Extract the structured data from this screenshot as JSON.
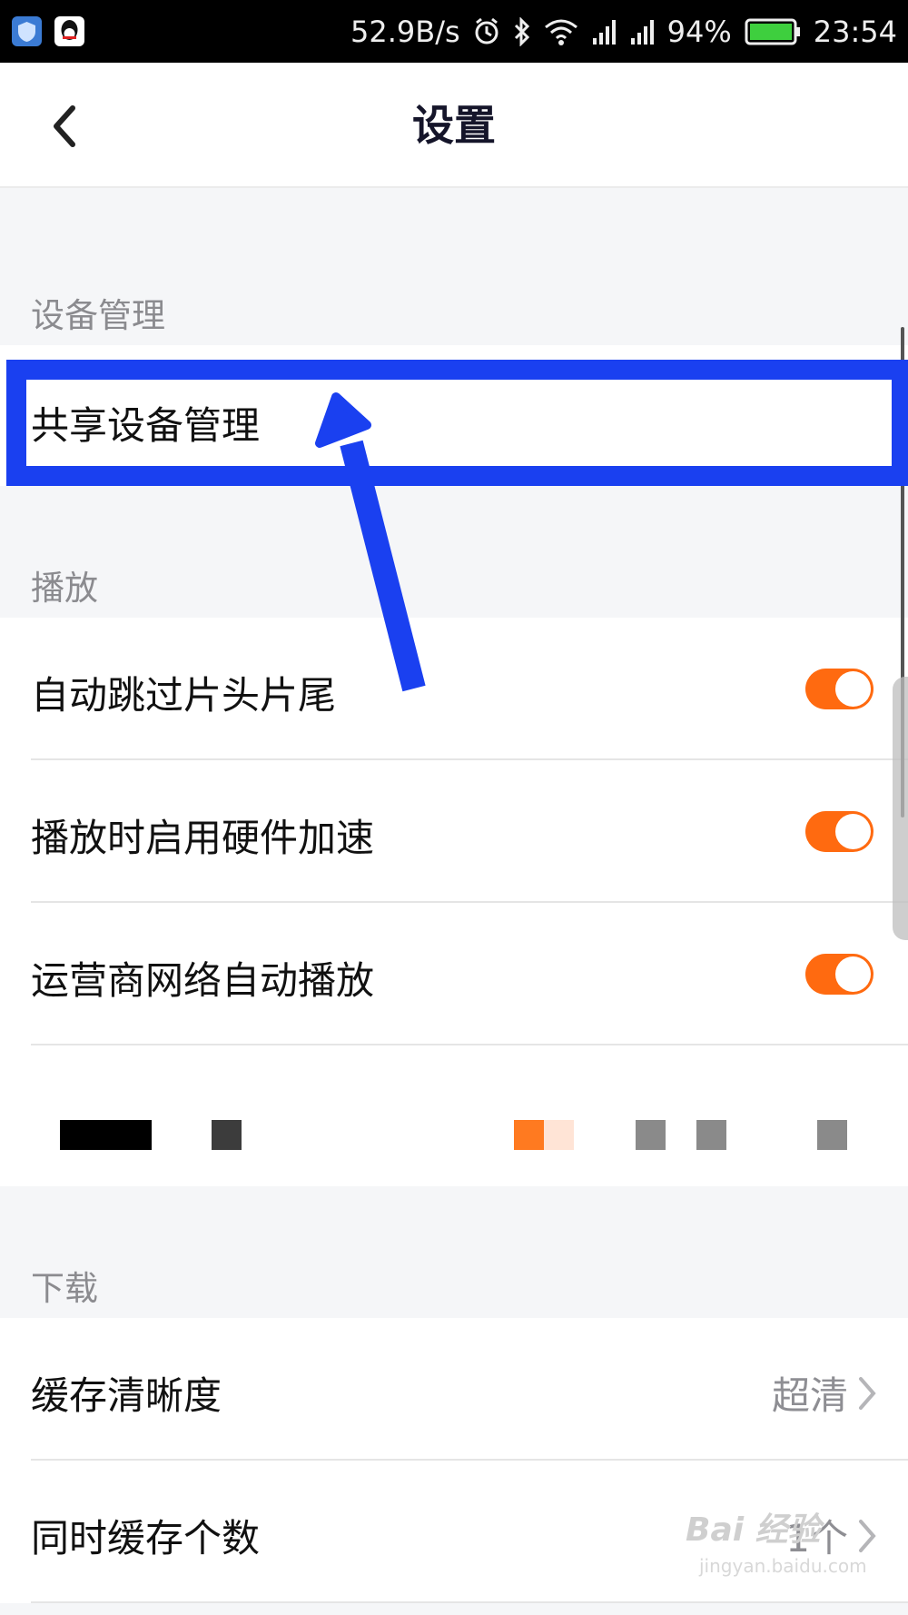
{
  "status_bar": {
    "net_speed": "52.9B/s",
    "battery": "94%",
    "time": "23:54",
    "icons": [
      "shield-app-icon",
      "qq-app-icon",
      "alarm-icon",
      "bluetooth-icon",
      "wifi-icon",
      "signal-icon",
      "signal-icon",
      "battery-icon"
    ]
  },
  "header": {
    "title": "设置",
    "back_icon": "chevron-left-icon"
  },
  "sections": {
    "device": {
      "title": "设备管理",
      "item": "共享设备管理"
    },
    "playback": {
      "title": "播放",
      "items": [
        {
          "label": "自动跳过片头片尾",
          "on": true
        },
        {
          "label": "播放时启用硬件加速",
          "on": true
        },
        {
          "label": "运营商网络自动播放",
          "on": true
        }
      ]
    },
    "download": {
      "title": "下载",
      "items": [
        {
          "label": "缓存清晰度",
          "value": "超清"
        },
        {
          "label": "同时缓存个数",
          "value": "1个"
        }
      ]
    }
  },
  "annotation": {
    "highlight_color": "#1a40f0",
    "arrow_color": "#1a40f0"
  },
  "accent_color": "#ff6a10",
  "watermark": {
    "text": "Bai 经验",
    "sub": "jingyan.baidu.com"
  }
}
